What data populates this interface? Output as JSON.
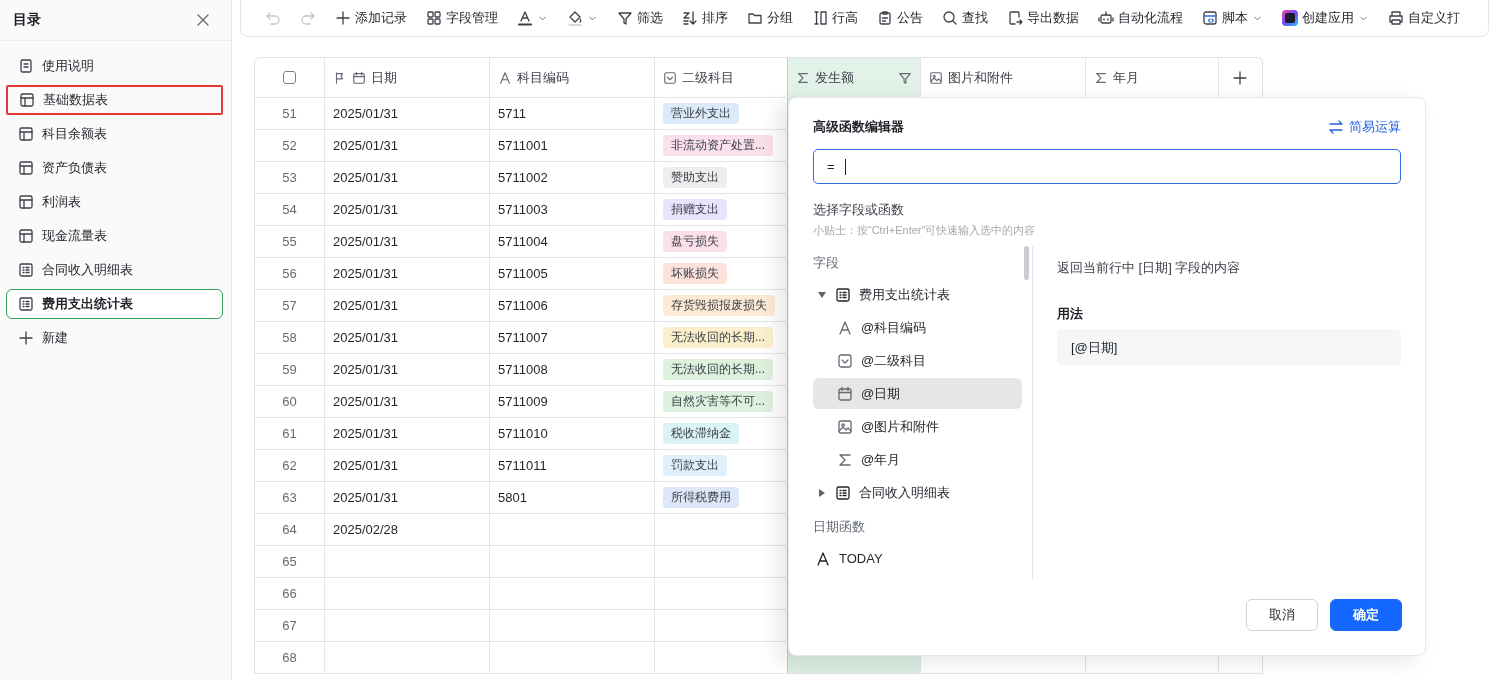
{
  "sidebar": {
    "title": "目录",
    "items": [
      {
        "label": "使用说明",
        "kind": "doc",
        "selected": false,
        "highlighted": false
      },
      {
        "label": "基础数据表",
        "kind": "table",
        "selected": false,
        "highlighted": true
      },
      {
        "label": "科目余额表",
        "kind": "table",
        "selected": false,
        "highlighted": false
      },
      {
        "label": "资产负债表",
        "kind": "table",
        "selected": false,
        "highlighted": false
      },
      {
        "label": "利润表",
        "kind": "table",
        "selected": false,
        "highlighted": false
      },
      {
        "label": "现金流量表",
        "kind": "table",
        "selected": false,
        "highlighted": false
      },
      {
        "label": "合同收入明细表",
        "kind": "form",
        "selected": false,
        "highlighted": false
      },
      {
        "label": "费用支出统计表",
        "kind": "form",
        "selected": true,
        "highlighted": false
      }
    ],
    "new_label": "新建"
  },
  "toolbar": [
    {
      "kind": "undo",
      "disabled": true,
      "dropdown": false
    },
    {
      "kind": "redo",
      "disabled": true,
      "dropdown": false
    },
    {
      "kind": "plus",
      "label": "添加记录",
      "disabled": false,
      "dropdown": false
    },
    {
      "kind": "grid",
      "label": "字段管理",
      "disabled": false,
      "dropdown": false
    },
    {
      "kind": "text-color",
      "disabled": false,
      "dropdown": true
    },
    {
      "kind": "fill",
      "disabled": false,
      "dropdown": true
    },
    {
      "kind": "filter",
      "label": "筛选",
      "disabled": false,
      "dropdown": false
    },
    {
      "kind": "sort",
      "label": "排序",
      "disabled": false,
      "dropdown": false
    },
    {
      "kind": "folder",
      "label": "分组",
      "disabled": false,
      "dropdown": false
    },
    {
      "kind": "row-height",
      "label": "行高",
      "disabled": false,
      "dropdown": false
    },
    {
      "kind": "notice",
      "label": "公告",
      "disabled": false,
      "dropdown": false
    },
    {
      "kind": "search",
      "label": "查找",
      "disabled": false,
      "dropdown": false
    },
    {
      "kind": "export",
      "label": "导出数据",
      "disabled": false,
      "dropdown": false
    },
    {
      "kind": "robot",
      "label": "自动化流程",
      "disabled": false,
      "dropdown": false
    },
    {
      "kind": "script",
      "label": "脚本",
      "disabled": false,
      "dropdown": true
    },
    {
      "kind": "app",
      "label": "创建应用",
      "disabled": false,
      "dropdown": true
    },
    {
      "kind": "printer",
      "label": "自定义打",
      "disabled": false,
      "dropdown": false
    }
  ],
  "table": {
    "header_checkbox": {
      "checked": false
    },
    "columns": [
      {
        "label": "日期",
        "kind": "date",
        "primary": true,
        "selected": false,
        "filtered": false
      },
      {
        "label": "科目编码",
        "kind": "text",
        "primary": false,
        "selected": false,
        "filtered": false
      },
      {
        "label": "二级科目",
        "kind": "select",
        "primary": false,
        "selected": false,
        "filtered": false
      },
      {
        "label": "发生额",
        "kind": "formula",
        "primary": false,
        "selected": true,
        "filtered": true
      },
      {
        "label": "图片和附件",
        "kind": "image",
        "primary": false,
        "selected": false,
        "filtered": false
      },
      {
        "label": "年月",
        "kind": "formula",
        "primary": false,
        "selected": false,
        "filtered": false
      }
    ],
    "rows": [
      {
        "num": "51",
        "date": "2025/01/31",
        "code": "5711",
        "tag": {
          "text": "营业外支出",
          "color": "#dce9f8"
        }
      },
      {
        "num": "52",
        "date": "2025/01/31",
        "code": "5711001",
        "tag": {
          "text": "非流动资产处置...",
          "color": "#f9e0ea"
        }
      },
      {
        "num": "53",
        "date": "2025/01/31",
        "code": "5711002",
        "tag": {
          "text": "赞助支出",
          "color": "#eeeeee"
        }
      },
      {
        "num": "54",
        "date": "2025/01/31",
        "code": "5711003",
        "tag": {
          "text": "捐赠支出",
          "color": "#e8e4fb"
        }
      },
      {
        "num": "55",
        "date": "2025/01/31",
        "code": "5711004",
        "tag": {
          "text": "盘亏损失",
          "color": "#fbe0ea"
        }
      },
      {
        "num": "56",
        "date": "2025/01/31",
        "code": "5711005",
        "tag": {
          "text": "坏账损失",
          "color": "#fde2dc"
        }
      },
      {
        "num": "57",
        "date": "2025/01/31",
        "code": "5711006",
        "tag": {
          "text": "存货毁损报废损失",
          "color": "#fdebd5"
        }
      },
      {
        "num": "58",
        "date": "2025/01/31",
        "code": "5711007",
        "tag": {
          "text": "无法收回的长期...",
          "color": "#fcf0cc"
        }
      },
      {
        "num": "59",
        "date": "2025/01/31",
        "code": "5711008",
        "tag": {
          "text": "无法收回的长期...",
          "color": "#ddf1dd"
        }
      },
      {
        "num": "60",
        "date": "2025/01/31",
        "code": "5711009",
        "tag": {
          "text": "自然灾害等不可...",
          "color": "#ddf1de"
        }
      },
      {
        "num": "61",
        "date": "2025/01/31",
        "code": "5711010",
        "tag": {
          "text": "税收滞纳金",
          "color": "#d9f3f6"
        }
      },
      {
        "num": "62",
        "date": "2025/01/31",
        "code": "5711011",
        "tag": {
          "text": "罚款支出",
          "color": "#dff0fb"
        }
      },
      {
        "num": "63",
        "date": "2025/01/31",
        "code": "5801",
        "tag": {
          "text": "所得税费用",
          "color": "#dce8f8"
        }
      },
      {
        "num": "64",
        "date": "2025/02/28"
      },
      {
        "num": "65"
      },
      {
        "num": "66"
      },
      {
        "num": "67"
      },
      {
        "num": "68"
      }
    ]
  },
  "formula_editor": {
    "title": "高级函数编辑器",
    "switch_link": "简易运算",
    "input": {
      "value": "="
    },
    "section_title": "选择字段或函数",
    "tip": "小贴士：按“Ctrl+Enter”可快速输入选中的内容",
    "groups": [
      {
        "label": "字段",
        "items": [
          {
            "kind": "table",
            "label": "费用支出统计表",
            "expanded": true,
            "selected": false,
            "children": [
              {
                "kind": "text",
                "label": "@科目编码",
                "selected": false
              },
              {
                "kind": "select",
                "label": "@二级科目",
                "selected": false
              },
              {
                "kind": "date",
                "label": "@日期",
                "selected": true
              },
              {
                "kind": "image",
                "label": "@图片和附件",
                "selected": false
              },
              {
                "kind": "formula",
                "label": "@年月",
                "selected": false
              }
            ]
          },
          {
            "kind": "table",
            "label": "合同收入明细表",
            "expanded": false,
            "selected": false
          }
        ]
      },
      {
        "label": "日期函数",
        "items": [
          {
            "kind": "function",
            "label": "TODAY",
            "selected": false
          }
        ]
      }
    ],
    "description": "返回当前行中 [日期] 字段的内容",
    "usage_title": "用法",
    "usage": "[@日期]",
    "buttons": [
      {
        "label": "取消",
        "kind": "secondary"
      },
      {
        "label": "确定",
        "kind": "primary"
      }
    ]
  }
}
